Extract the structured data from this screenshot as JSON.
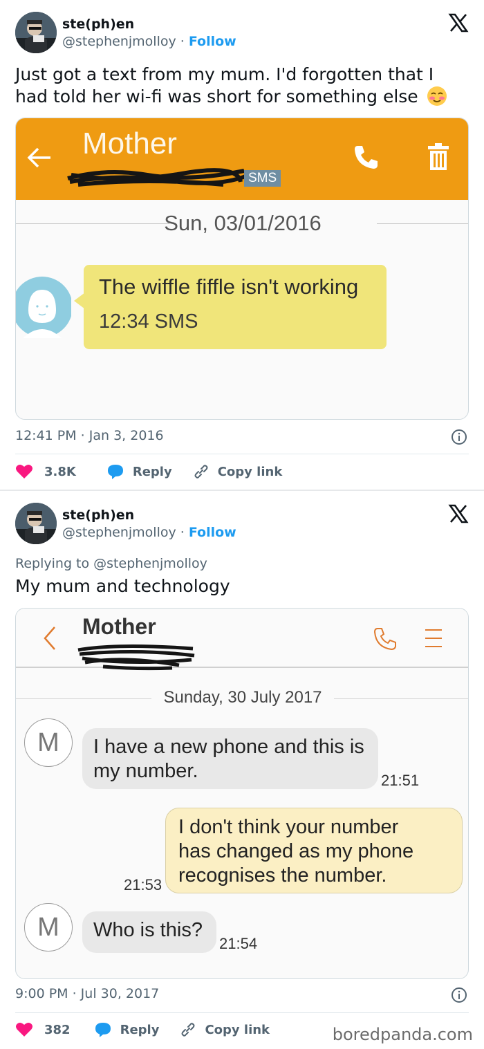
{
  "tweets": [
    {
      "author_name": "ste(ph)en",
      "author_handle": "@stephenjmolloy",
      "separator": " · ",
      "follow_label": "Follow",
      "text": "Just got a text from my mum. I'd forgotten that I had told her wi-fi was short for something else",
      "emoji": "blushing-face-icon",
      "screenshot": {
        "contact": "Mother",
        "sms_tag": "SMS",
        "date": "Sun, 03/01/2016",
        "message": "The wiffle fiffle isn't working",
        "message_time": "12:34 SMS",
        "header_color": "#ef9b12",
        "bubble_color": "#f0e57a"
      },
      "timestamp": "12:41 PM · Jan 3, 2016",
      "likes": "3.8K",
      "reply_label": "Reply",
      "copy_label": "Copy link"
    },
    {
      "author_name": "ste(ph)en",
      "author_handle": "@stephenjmolloy",
      "separator": " · ",
      "follow_label": "Follow",
      "replying_to": "Replying to @stephenjmolloy",
      "text": "My mum and technology",
      "screenshot": {
        "contact": "Mother",
        "date": "Sunday, 30 July 2017",
        "avatar_letter": "M",
        "messages": [
          {
            "direction": "in",
            "text": "I have a new phone and this is my number.",
            "line1": "I have a new phone and this is",
            "line2": "my number.",
            "time": "21:51"
          },
          {
            "direction": "out",
            "text": "I don't think your number has changed as my phone recognises the number.",
            "line1": "I don't think your number",
            "line2": "has changed as my phone",
            "line3": "recognises the number.",
            "time": "21:53"
          },
          {
            "direction": "in",
            "text": "Who is this?",
            "time": "21:54"
          }
        ]
      },
      "timestamp": "9:00 PM · Jul 30, 2017",
      "likes": "382",
      "reply_label": "Reply",
      "copy_label": "Copy link"
    }
  ],
  "colors": {
    "like": "#f91880",
    "reply": "#1d9bf0",
    "follow": "#1d9bf0"
  },
  "watermark": "boredpanda.com"
}
